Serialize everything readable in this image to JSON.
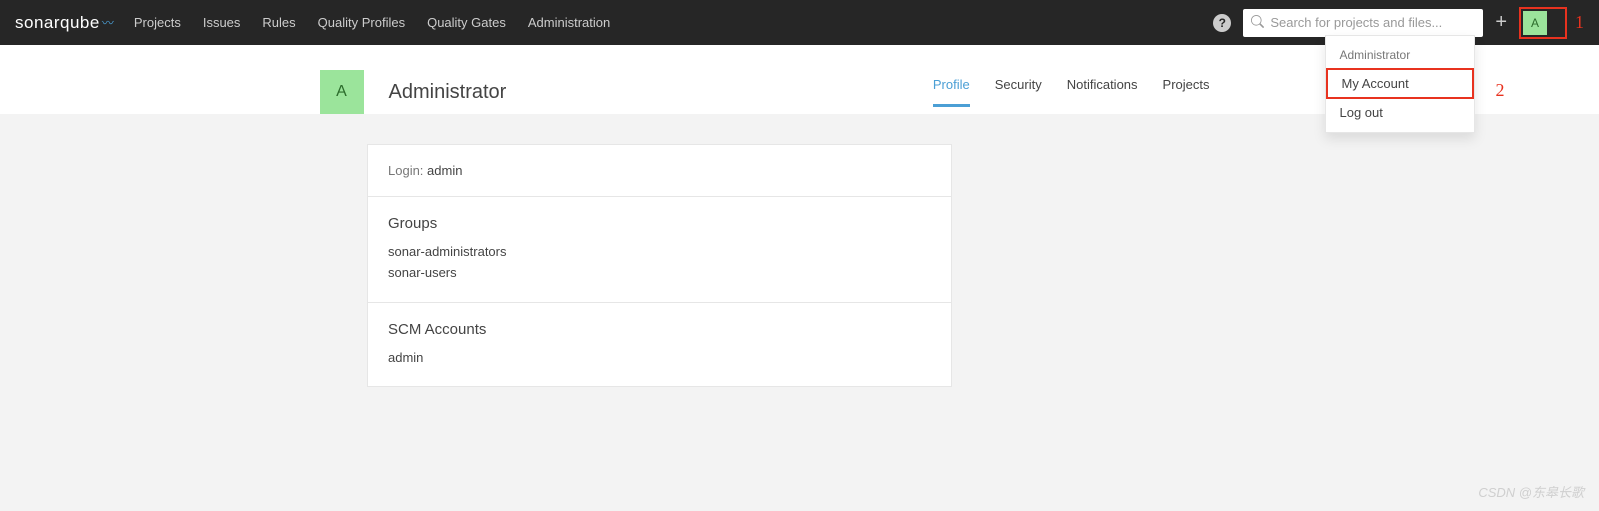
{
  "brand": "sonarqube",
  "nav": {
    "items": [
      "Projects",
      "Issues",
      "Rules",
      "Quality Profiles",
      "Quality Gates",
      "Administration"
    ]
  },
  "search": {
    "placeholder": "Search for projects and files..."
  },
  "avatar_letter": "A",
  "annotations": {
    "one": "1",
    "two": "2"
  },
  "header": {
    "avatar_letter": "A",
    "title": "Administrator",
    "tabs": [
      "Profile",
      "Security",
      "Notifications",
      "Projects"
    ],
    "active_tab": 0
  },
  "dropdown": {
    "header": "Administrator",
    "my_account": "My Account",
    "log_out": "Log out"
  },
  "profile": {
    "login_label": "Login:",
    "login_value": "admin",
    "groups_title": "Groups",
    "groups": [
      "sonar-administrators",
      "sonar-users"
    ],
    "scm_title": "SCM Accounts",
    "scm": [
      "admin"
    ]
  },
  "watermark": "CSDN @东皋长歌"
}
